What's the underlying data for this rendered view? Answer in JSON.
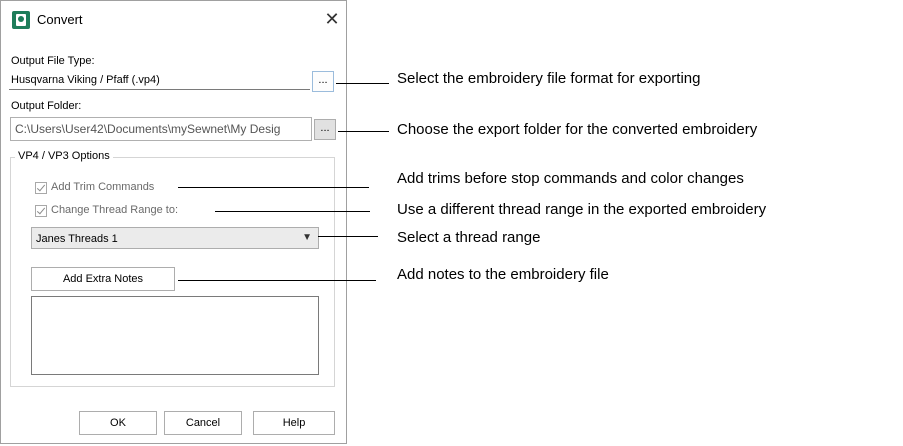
{
  "dialog": {
    "title": "Convert",
    "output_file_type_label": "Output File Type:",
    "output_file_type_value": "Husqvarna Viking / Pfaff (.vp4)",
    "browse_label": "...",
    "output_folder_label": "Output Folder:",
    "output_folder_value": "C:\\Users\\User42\\Documents\\mySewnet\\My Desig",
    "group_title": "VP4 / VP3 Options",
    "add_trim_label": "Add Trim Commands",
    "change_thread_label": "Change Thread Range to:",
    "thread_range_value": "Janes Threads 1",
    "add_notes_label": "Add Extra Notes",
    "ok_label": "OK",
    "cancel_label": "Cancel",
    "help_label": "Help"
  },
  "callouts": [
    "Select the embroidery file format for exporting",
    "Choose the export folder for the converted embroidery",
    "Add trims before stop commands and color changes",
    "Use a different thread range in the exported embroidery",
    "Select a thread range",
    "Add notes to the embroidery file"
  ]
}
